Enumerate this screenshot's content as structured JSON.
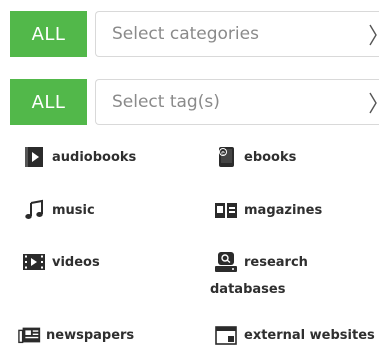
{
  "categories_filter": {
    "all_label": "ALL",
    "placeholder": "Select categories"
  },
  "tags_filter": {
    "all_label": "ALL",
    "placeholder": "Select tag(s)"
  },
  "category_links": {
    "audiobooks": "audiobooks",
    "ebooks": "ebooks",
    "music": "music",
    "magazines": "magazines",
    "videos": "videos",
    "research_line1": "research",
    "research_line2": "databases",
    "newspapers": "newspapers",
    "external_websites": "external websites"
  },
  "colors": {
    "accent_green": "#52b84a",
    "icon_dark": "#2b2b2b"
  },
  "icons": {
    "audiobooks": "play-square-icon",
    "ebooks": "ebook-icon",
    "music": "music-note-icon",
    "magazines": "magazine-icon",
    "videos": "film-icon",
    "research_databases": "database-search-icon",
    "newspapers": "newspaper-icon",
    "external_websites": "browser-window-icon"
  }
}
